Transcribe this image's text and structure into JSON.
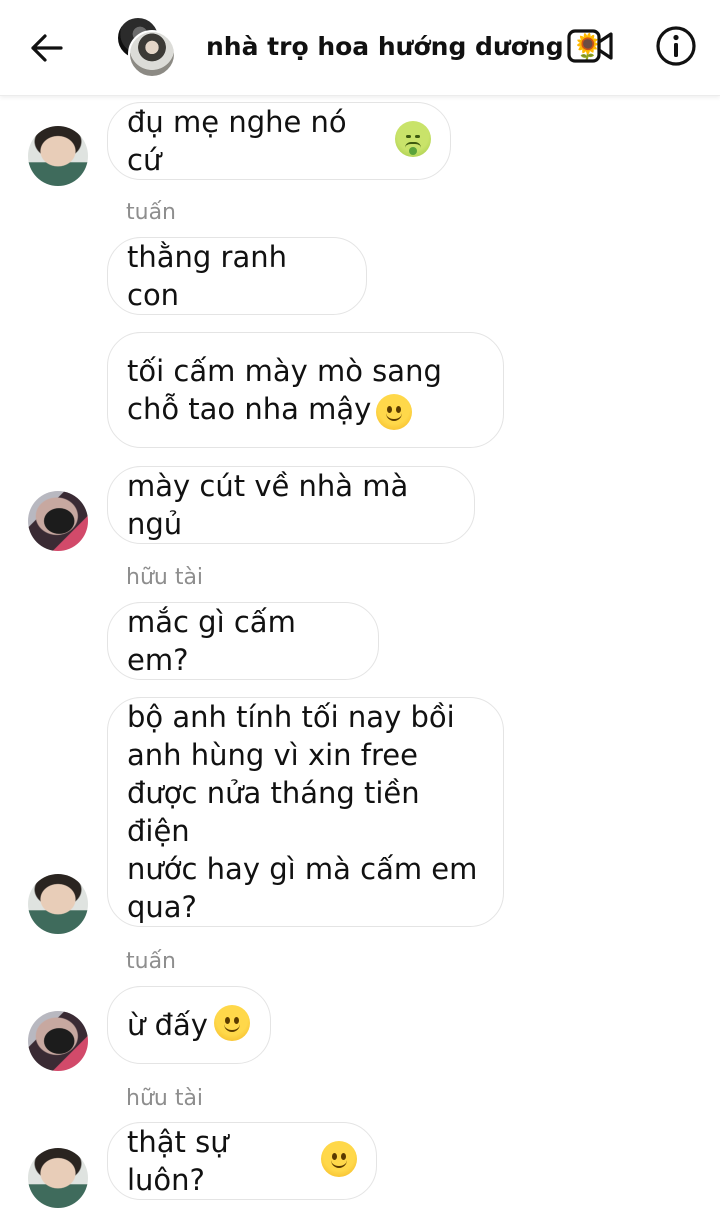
{
  "header": {
    "title": "nhà trọ hoa hướng dương 🌻",
    "back_icon": "arrow-left-icon",
    "video_icon": "video-camera-icon",
    "info_icon": "info-icon"
  },
  "messages": [
    {
      "sender_label": "",
      "text": "đụ mẹ nghe nó cứ",
      "emoji": "nauseated-face"
    },
    {
      "sender_label": "tuấn",
      "text": "thằng ranh con",
      "emoji": ""
    },
    {
      "sender_label": "",
      "text": "tối cấm mày mò sang\nchỗ tao nha mậy",
      "emoji": "slightly-smiling-face"
    },
    {
      "sender_label": "",
      "text": "mày cút về nhà mà ngủ",
      "emoji": ""
    },
    {
      "sender_label": "hữu tài",
      "text": "mắc gì cấm em?",
      "emoji": ""
    },
    {
      "sender_label": "",
      "text": "bộ anh tính tối nay bồi\nanh hùng vì xin free\nđược nửa tháng tiền điện\nnước hay gì mà cấm em\nqua?",
      "emoji": ""
    },
    {
      "sender_label": "tuấn",
      "text": "ừ đấy",
      "emoji": "slightly-smiling-face"
    },
    {
      "sender_label": "hữu tài",
      "text": "thật sự luôn?",
      "emoji": "slightly-smiling-face"
    }
  ],
  "colors": {
    "bubble_border": "#e4e4e4",
    "sender_label": "#8e8e8e",
    "background": "#ffffff"
  }
}
